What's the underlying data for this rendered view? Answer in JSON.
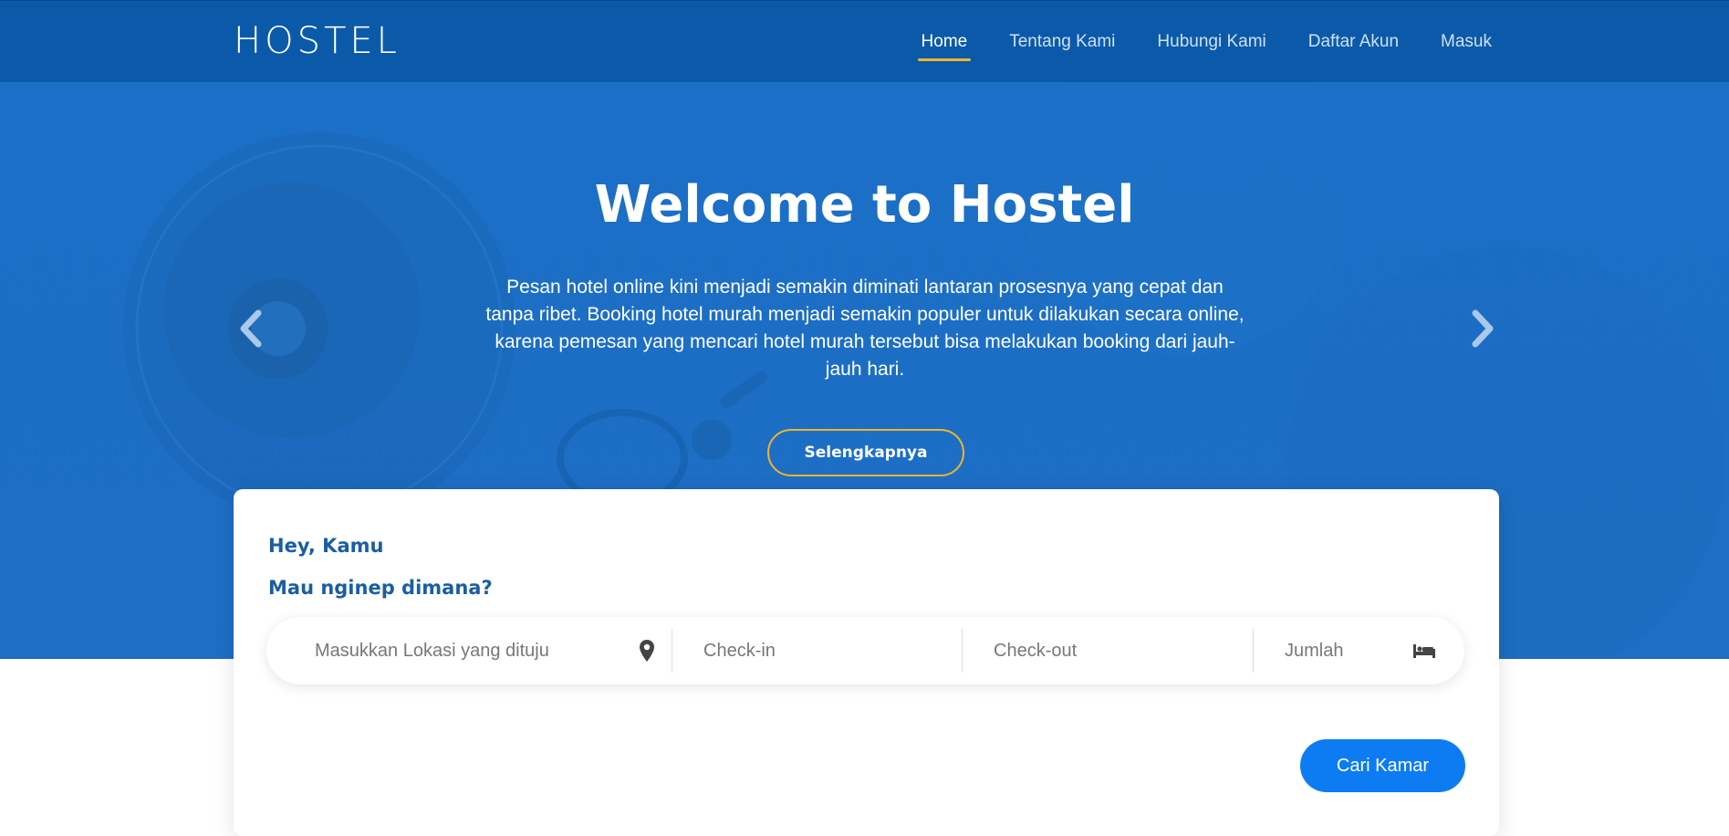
{
  "navbar": {
    "brand": "HOSTEL",
    "links": [
      {
        "label": "Home",
        "active": true
      },
      {
        "label": "Tentang Kami",
        "active": false
      },
      {
        "label": "Hubungi Kami",
        "active": false
      },
      {
        "label": "Daftar Akun",
        "active": false
      },
      {
        "label": "Masuk",
        "active": false
      }
    ],
    "accent": "#f0b429",
    "background": "#0b5aa9"
  },
  "hero": {
    "title": "Welcome to Hostel",
    "text": "Pesan hotel online kini menjadi semakin diminati lantaran prosesnya yang cepat dan tanpa ribet. Booking hotel murah menjadi semakin populer untuk dilakukan secara online, karena pemesan yang mencari hotel murah tersebut bisa melakukan booking dari jauh-jauh hari.",
    "button_label": "Selengkapnya",
    "background": "#1d6ec4",
    "prev_icon": "chevron-left-icon",
    "next_icon": "chevron-right-icon"
  },
  "search": {
    "greeting": "Hey, Kamu",
    "question": "Mau nginep dimana?",
    "location_placeholder": "Masukkan Lokasi yang dituju",
    "location_icon": "map-pin-icon",
    "checkin_placeholder": "Check-in",
    "checkout_placeholder": "Check-out",
    "guests_placeholder": "Jumlah",
    "guests_icon": "bed-icon",
    "submit_label": "Cari Kamar",
    "submit_color": "#0d7cf2"
  }
}
